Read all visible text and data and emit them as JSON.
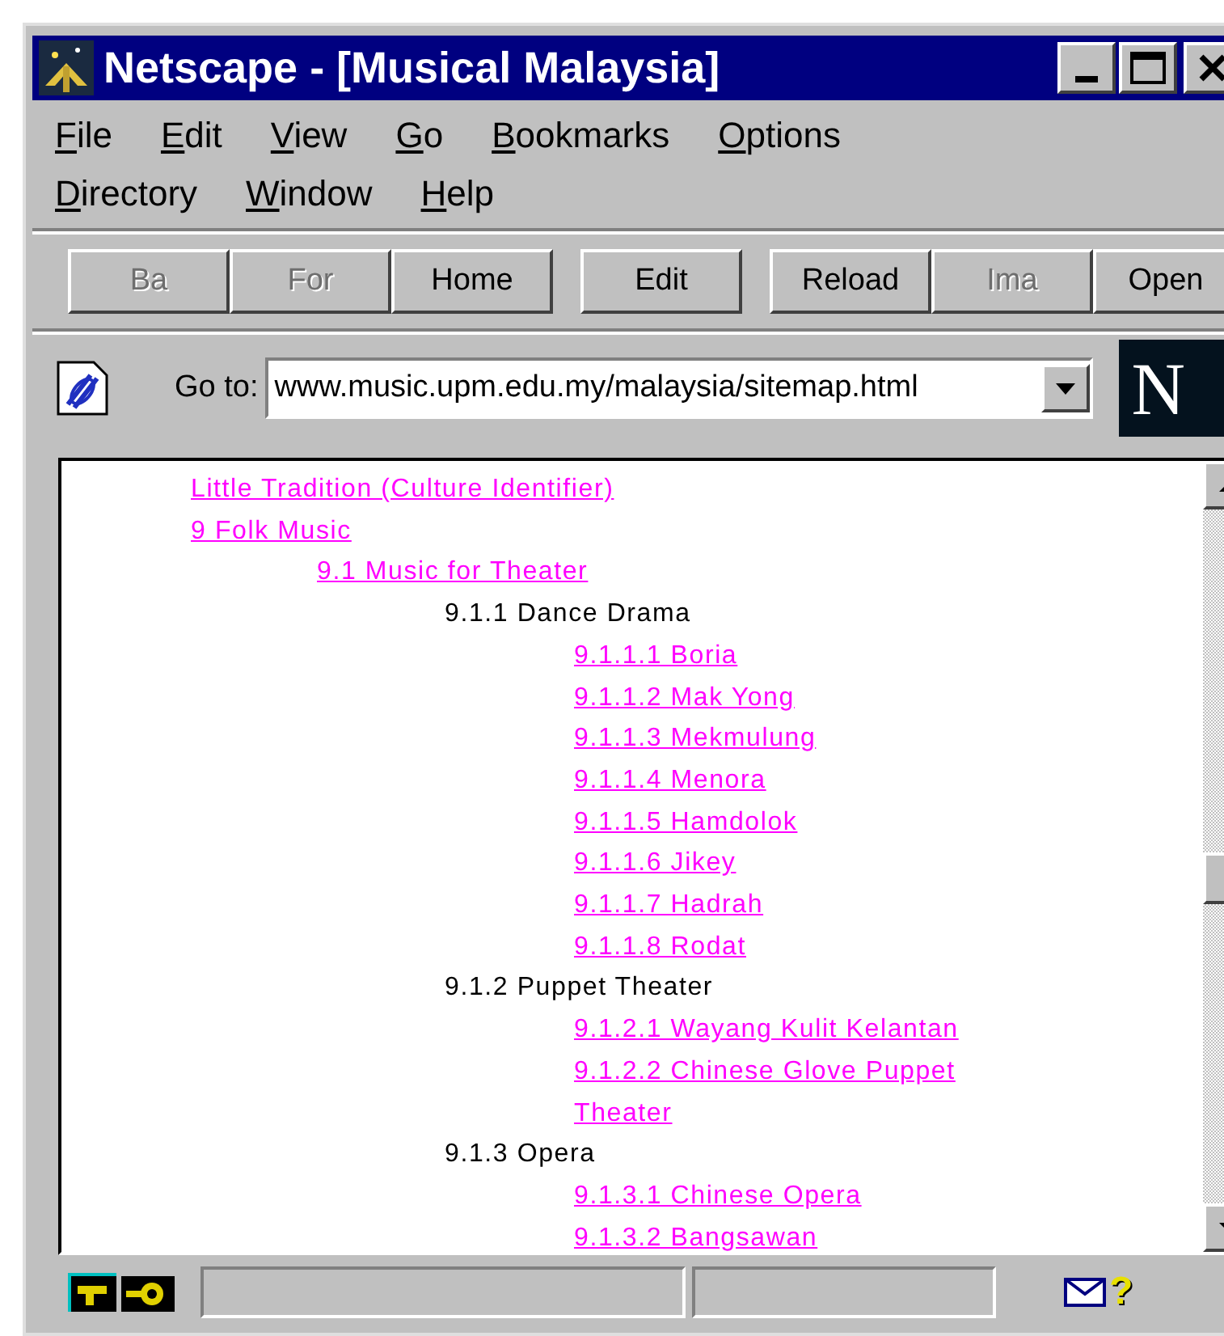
{
  "window": {
    "title": "Netscape - [Musical Malaysia]"
  },
  "menu_rows": [
    [
      "File",
      "Edit",
      "View",
      "Go",
      "Bookmarks",
      "Options"
    ],
    [
      "Directory",
      "Window",
      "Help"
    ]
  ],
  "toolbar": [
    {
      "label": "Ba",
      "disabled": true
    },
    {
      "label": "For",
      "disabled": true
    },
    {
      "label": "Home",
      "disabled": false
    },
    {
      "label": "Edit",
      "disabled": false
    },
    {
      "label": "Reload",
      "disabled": false
    },
    {
      "label": "Ima",
      "disabled": true
    },
    {
      "label": "Open",
      "disabled": false
    }
  ],
  "location": {
    "label": "Go to:",
    "value": "www.music.upm.edu.my/malaysia/sitemap.html",
    "logo": "N"
  },
  "sitemap": [
    {
      "kind": "link",
      "text": "Little Tradition (Culture Identifier)"
    },
    {
      "kind": "link",
      "text": "9 Folk Music",
      "children": [
        {
          "kind": "link",
          "text": "9.1 Music for Theater",
          "children": [
            {
              "kind": "heading",
              "text": "9.1.1 Dance Drama",
              "children": [
                {
                  "kind": "link",
                  "text": "9.1.1.1 Boria"
                },
                {
                  "kind": "link",
                  "text": "9.1.1.2 Mak Yong"
                },
                {
                  "kind": "link",
                  "text": "9.1.1.3 Mekmulung"
                },
                {
                  "kind": "link",
                  "text": "9.1.1.4 Menora"
                },
                {
                  "kind": "link",
                  "text": "9.1.1.5 Hamdolok"
                },
                {
                  "kind": "link",
                  "text": "9.1.1.6 Jikey"
                },
                {
                  "kind": "link",
                  "text": "9.1.1.7 Hadrah"
                },
                {
                  "kind": "link",
                  "text": "9.1.1.8 Rodat"
                }
              ]
            },
            {
              "kind": "heading",
              "text": "9.1.2 Puppet Theater",
              "children": [
                {
                  "kind": "link",
                  "text": "9.1.2.1 Wayang Kulit Kelantan"
                },
                {
                  "kind": "link",
                  "text": "9.1.2.2 Chinese Glove Puppet Theater"
                }
              ]
            },
            {
              "kind": "heading",
              "text": "9.1.3 Opera",
              "children": [
                {
                  "kind": "link",
                  "text": "9.1.3.1 Chinese Opera"
                },
                {
                  "kind": "link",
                  "text": "9.1.3.2 Bangsawan"
                }
              ]
            }
          ]
        }
      ]
    }
  ],
  "status_bar": {
    "help_glyph": "?"
  }
}
